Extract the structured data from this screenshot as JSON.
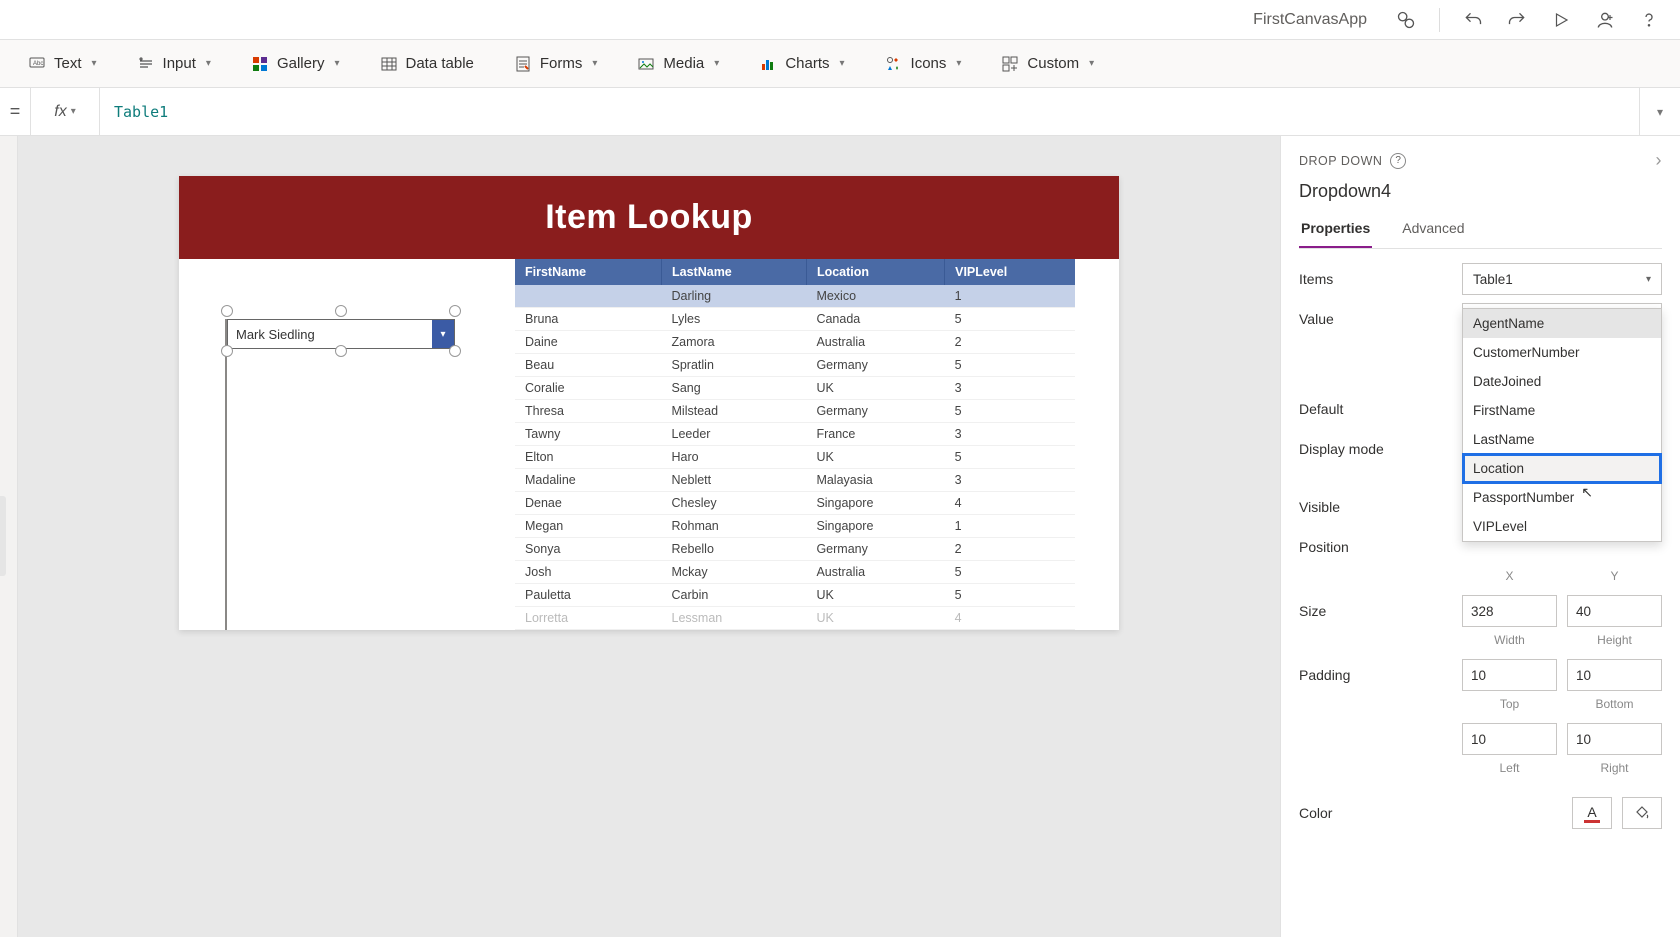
{
  "titlebar": {
    "appname": "FirstCanvasApp"
  },
  "ribbon": {
    "text": "Text",
    "input": "Input",
    "gallery": "Gallery",
    "datatable": "Data table",
    "forms": "Forms",
    "media": "Media",
    "charts": "Charts",
    "icons": "Icons",
    "custom": "Custom"
  },
  "formula": {
    "eq": "=",
    "fx": "fx",
    "value": "Table1"
  },
  "canvas": {
    "banner": "Item Lookup",
    "dropdown_value": "Mark Siedling",
    "columns": [
      "FirstName",
      "LastName",
      "Location",
      "VIPLevel"
    ],
    "rows": [
      [
        "",
        "Darling",
        "Mexico",
        "1"
      ],
      [
        "Bruna",
        "Lyles",
        "Canada",
        "5"
      ],
      [
        "Daine",
        "Zamora",
        "Australia",
        "2"
      ],
      [
        "Beau",
        "Spratlin",
        "Germany",
        "5"
      ],
      [
        "Coralie",
        "Sang",
        "UK",
        "3"
      ],
      [
        "Thresa",
        "Milstead",
        "Germany",
        "5"
      ],
      [
        "Tawny",
        "Leeder",
        "France",
        "3"
      ],
      [
        "Elton",
        "Haro",
        "UK",
        "5"
      ],
      [
        "Madaline",
        "Neblett",
        "Malayasia",
        "3"
      ],
      [
        "Denae",
        "Chesley",
        "Singapore",
        "4"
      ],
      [
        "Megan",
        "Rohman",
        "Singapore",
        "1"
      ],
      [
        "Sonya",
        "Rebello",
        "Germany",
        "2"
      ],
      [
        "Josh",
        "Mckay",
        "Australia",
        "5"
      ],
      [
        "Pauletta",
        "Carbin",
        "UK",
        "5"
      ],
      [
        "Lorretta",
        "Lessman",
        "UK",
        "4"
      ]
    ]
  },
  "rpane": {
    "type": "DROP DOWN",
    "name": "Dropdown4",
    "tab_properties": "Properties",
    "tab_advanced": "Advanced",
    "labels": {
      "items": "Items",
      "value": "Value",
      "default": "Default",
      "display": "Display mode",
      "visible": "Visible",
      "position": "Position",
      "size": "Size",
      "padding": "Padding",
      "color": "Color",
      "x": "X",
      "y": "Y",
      "width": "Width",
      "height": "Height",
      "top": "Top",
      "bottom": "Bottom",
      "left": "Left",
      "right": "Right"
    },
    "items_value": "Table1",
    "value_value": "AgentName",
    "size_w": "328",
    "size_h": "40",
    "pad_t": "10",
    "pad_b": "10",
    "pad_l": "10",
    "pad_r": "10",
    "options": [
      "AgentName",
      "CustomerNumber",
      "DateJoined",
      "FirstName",
      "LastName",
      "Location",
      "PassportNumber",
      "VIPLevel"
    ],
    "option_selected": "AgentName",
    "option_highlighted": "Location"
  }
}
